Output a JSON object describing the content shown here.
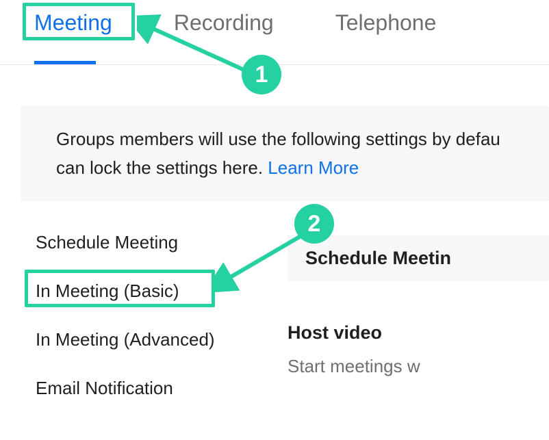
{
  "tabs": {
    "meeting": "Meeting",
    "recording": "Recording",
    "telephone": "Telephone"
  },
  "banner": {
    "text_part1": "Groups members will use the following settings by defau",
    "text_part2": "can lock the settings here. ",
    "learn_more": "Learn More"
  },
  "sidebar": {
    "schedule": "Schedule Meeting",
    "basic": "In Meeting (Basic)",
    "advanced": "In Meeting (Advanced)",
    "email": "Email Notification"
  },
  "right": {
    "section_header": "Schedule Meetin",
    "setting_title": "Host video",
    "setting_desc": "Start meetings w"
  },
  "annotations": {
    "step1": "1",
    "step2": "2"
  }
}
